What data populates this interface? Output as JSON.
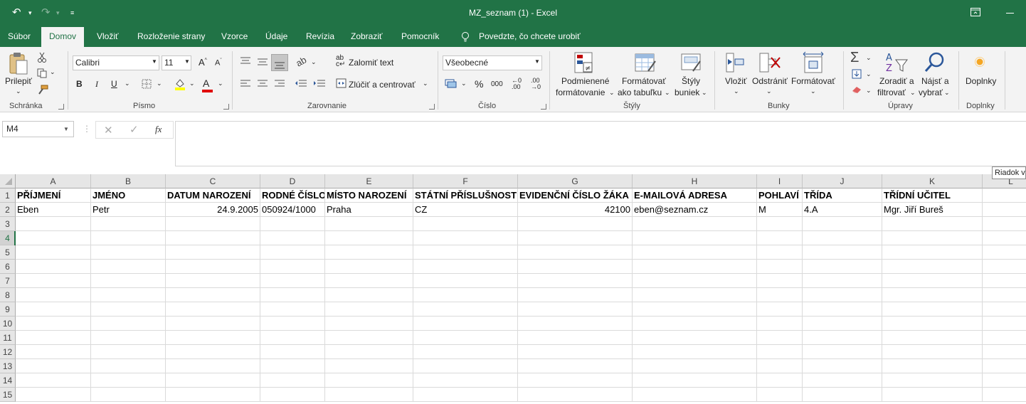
{
  "window": {
    "title": "MZ_seznam (1)  -  Excel"
  },
  "tabs": [
    {
      "label": "Súbor"
    },
    {
      "label": "Domov"
    },
    {
      "label": "Vložiť"
    },
    {
      "label": "Rozloženie strany"
    },
    {
      "label": "Vzorce"
    },
    {
      "label": "Údaje"
    },
    {
      "label": "Revízia"
    },
    {
      "label": "Zobraziť"
    },
    {
      "label": "Pomocník"
    }
  ],
  "tell_me": "Povedzte, čo chcete urobiť",
  "ribbon": {
    "clipboard": {
      "paste": "Prilepiť",
      "label": "Schránka"
    },
    "font": {
      "family": "Calibri",
      "size": "11",
      "bold": "B",
      "italic": "I",
      "underline": "U",
      "label": "Písmo"
    },
    "alignment": {
      "wrap": "Zalomiť text",
      "merge": "Zlúčiť a centrovať",
      "label": "Zarovnanie"
    },
    "number": {
      "format": "Všeobecné",
      "percent": "%",
      "thousands": "000",
      "label": "Číslo"
    },
    "styles": {
      "cond1": "Podmienené",
      "cond2": "formátovanie",
      "table1": "Formátovať",
      "table2": "ako tabuľku",
      "cell1": "Štýly",
      "cell2": "buniek",
      "label": "Štýly"
    },
    "cells": {
      "insert": "Vložiť",
      "delete": "Odstrániť",
      "format": "Formátovať",
      "label": "Bunky"
    },
    "editing": {
      "sort1": "Zoradiť a",
      "sort2": "filtrovať",
      "find1": "Nájsť a",
      "find2": "vybrať",
      "label": "Úpravy"
    },
    "addins": {
      "addins": "Doplnky",
      "label": "Doplnky"
    }
  },
  "formula_bar": {
    "name_box": "M4",
    "fx": "fx",
    "value": ""
  },
  "tooltip": "Riadok v",
  "columns": [
    "A",
    "B",
    "C",
    "D",
    "E",
    "F",
    "G",
    "H",
    "I",
    "J",
    "K",
    "L"
  ],
  "rows": [
    "1",
    "2",
    "3",
    "4",
    "5",
    "6",
    "7",
    "8",
    "9",
    "10",
    "11",
    "12",
    "13",
    "14",
    "15"
  ],
  "header_row": [
    "PŘÍJMENÍ",
    "JMÉNO",
    "DATUM NAROZENÍ",
    "RODNÉ ČÍSLO",
    "MÍSTO NAROZENÍ",
    "STÁTNÍ PŘÍSLUŠNOST",
    "EVIDENČNÍ ČÍSLO ŽÁKA",
    "E-MAILOVÁ ADRESA",
    "POHLAVÍ",
    "TŘÍDA",
    "TŘÍDNÍ UČITEL"
  ],
  "data_row": [
    "Eben",
    "Petr",
    "24.9.2005",
    "050924/1000",
    "Praha",
    "CZ",
    "42100",
    "eben@seznam.cz",
    "M",
    "4.A",
    "Mgr. Jiří Bureš"
  ],
  "active_cell": "M4",
  "colors": {
    "accent": "#217346",
    "ribbon_bg": "#f3f3f3"
  }
}
